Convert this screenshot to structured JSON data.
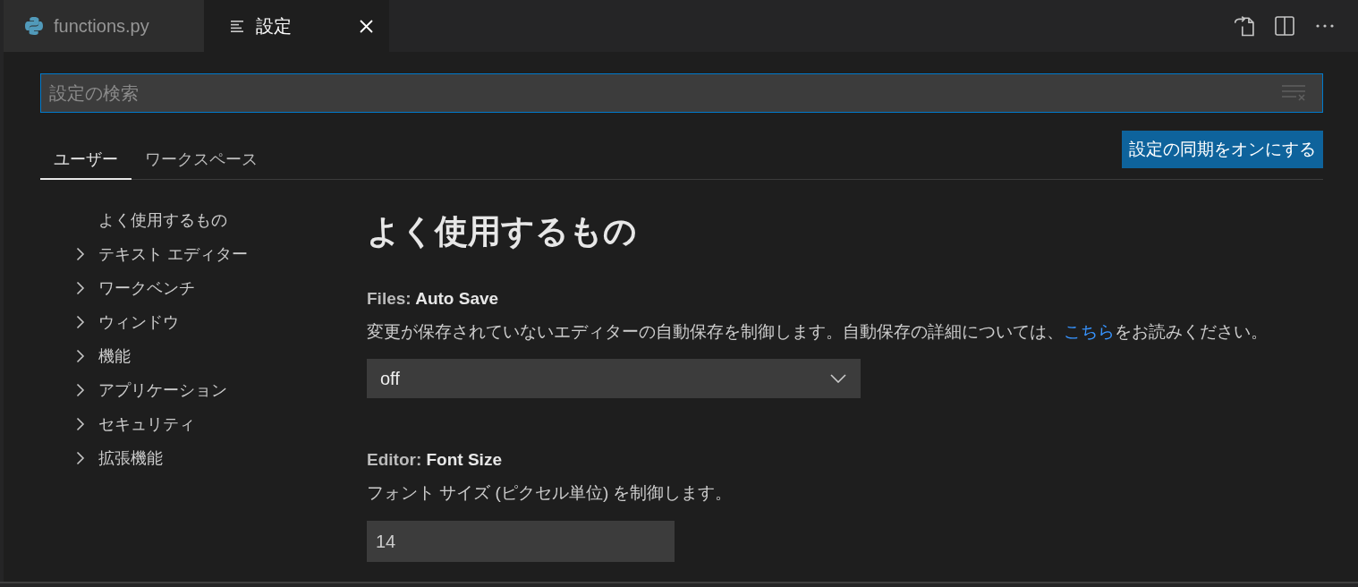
{
  "editor_tabs": [
    {
      "kind": "python",
      "label": "functions.py",
      "selected": false
    },
    {
      "kind": "settings",
      "label": "設定",
      "selected": true
    }
  ],
  "search": {
    "placeholder": "設定の検索"
  },
  "scope_tabs": [
    {
      "label": "ユーザー",
      "selected": true
    },
    {
      "label": "ワークスペース",
      "selected": false
    }
  ],
  "sync_button": {
    "label": "設定の同期をオンにする"
  },
  "toc": [
    {
      "kind": "leaf",
      "label": "よく使用するもの"
    },
    {
      "kind": "group",
      "label": "テキスト エディター",
      "expanded": false
    },
    {
      "kind": "group",
      "label": "ワークベンチ",
      "expanded": false
    },
    {
      "kind": "group",
      "label": "ウィンドウ",
      "expanded": false
    },
    {
      "kind": "group",
      "label": "機能",
      "expanded": false
    },
    {
      "kind": "group",
      "label": "アプリケーション",
      "expanded": false
    },
    {
      "kind": "group",
      "label": "セキュリティ",
      "expanded": false
    },
    {
      "kind": "group",
      "label": "拡張機能",
      "expanded": false
    }
  ],
  "section": {
    "title": "よく使用するもの",
    "settings": [
      {
        "kind": "dropdown",
        "category": "Files:",
        "name": "Auto Save",
        "description": [
          {
            "kind": "text",
            "text": "変更が保存されていないエディターの自動保存を制御します。自動保存の詳細については、"
          },
          {
            "kind": "link",
            "text": "こちら"
          },
          {
            "kind": "text",
            "text": "をお読みください。"
          }
        ],
        "value": "off"
      },
      {
        "kind": "number",
        "category": "Editor:",
        "name": "Font Size",
        "description": [
          {
            "kind": "text",
            "text": "フォント サイズ (ピクセル単位) を制御します。"
          }
        ],
        "value": "14"
      }
    ]
  }
}
